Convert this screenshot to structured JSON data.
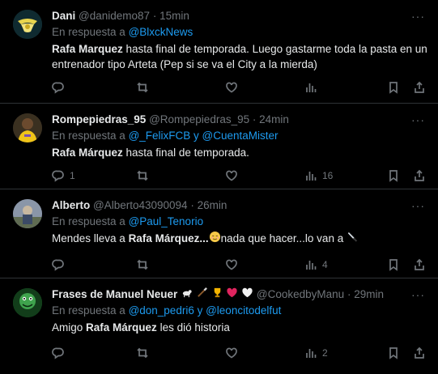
{
  "tweets": [
    {
      "name": "Dani",
      "handle": "@danidemo87",
      "time": "15min",
      "reply_prefix": "En respuesta a ",
      "reply_to": "@BlxckNews",
      "bold": "Rafa Marquez",
      "text": " hasta final de temporada. Luego gastarme toda la pasta en un entrenador tipo Arteta (Pep si se va el City a la mierda)",
      "replies": "",
      "retweets": "",
      "likes": "",
      "views": ""
    },
    {
      "name": "Rompepiedras_95",
      "handle": "@Rompepiedras_95",
      "time": "24min",
      "reply_prefix": "En respuesta a ",
      "reply_to": "@_FelixFCB",
      "reply_and": " y ",
      "reply_to2": "@CuentaMister",
      "bold": "Rafa Márquez",
      "text": " hasta final de temporada.",
      "replies": "1",
      "retweets": "",
      "likes": "",
      "views": "16"
    },
    {
      "name": "Alberto",
      "handle": "@Alberto43090094",
      "time": "26min",
      "reply_prefix": "En respuesta a ",
      "reply_to": "@Paul_Tenorio",
      "text_before": "Mendes lleva a ",
      "bold": "Rafa Márquez...",
      "text": "nada que hacer...lo van a ",
      "replies": "",
      "retweets": "",
      "likes": "",
      "views": "4"
    },
    {
      "name": "Frases de Manuel Neuer",
      "handle": "@CookedbyManu",
      "time": "29min",
      "reply_prefix": "En respuesta a ",
      "reply_to": "@don_pedri6",
      "reply_and": " y ",
      "reply_to2": "@leoncitodelfut",
      "text_before": "Amigo ",
      "bold": "Rafa Márquez",
      "text": " les dió historia",
      "replies": "",
      "retweets": "",
      "likes": "",
      "views": "2"
    }
  ],
  "dot": "·",
  "more": "···",
  "colors": {
    "background": "#000000",
    "text": "#e7e9ea",
    "muted": "#71767b",
    "link": "#1d9bf0",
    "divider": "#2f3336"
  },
  "icons": [
    "reply-icon",
    "retweet-icon",
    "like-icon",
    "views-icon",
    "bookmark-icon",
    "share-icon",
    "more-icon"
  ]
}
